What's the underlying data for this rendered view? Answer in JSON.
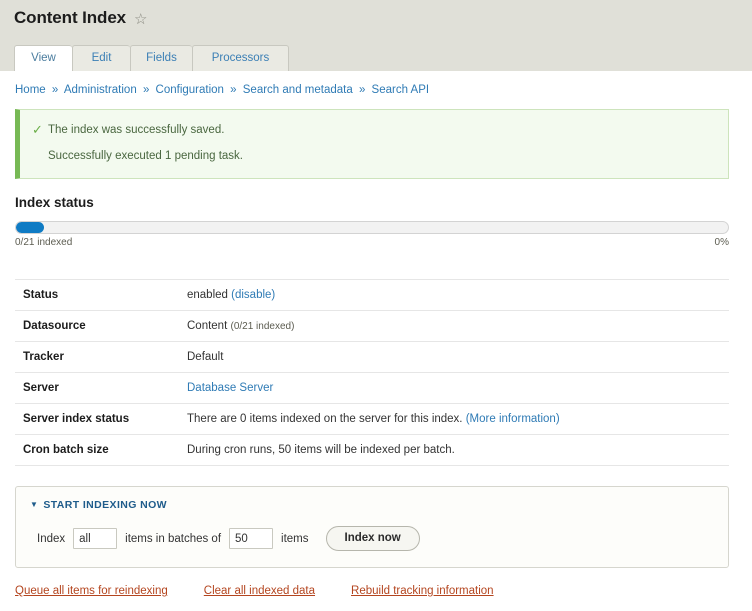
{
  "header": {
    "title": "Content Index",
    "star_icon": "star-outline-icon"
  },
  "tabs": [
    {
      "label": "View",
      "active": true
    },
    {
      "label": "Edit",
      "active": false
    },
    {
      "label": "Fields",
      "active": false
    },
    {
      "label": "Processors",
      "active": false
    }
  ],
  "breadcrumb": {
    "separator": "»",
    "items": [
      "Home",
      "Administration",
      "Configuration",
      "Search and metadata",
      "Search API"
    ]
  },
  "status_message": {
    "check_icon": "checkmark-icon",
    "lines": [
      "The index was successfully saved.",
      "Successfully executed 1 pending task."
    ]
  },
  "index_status": {
    "heading": "Index status",
    "progress_percent": 0,
    "progress_fill_width": "4%",
    "left_label": "0/21 indexed",
    "right_label": "0%"
  },
  "info_table": {
    "rows": [
      {
        "label": "Status",
        "value": "enabled",
        "link_text": "(disable)",
        "note": ""
      },
      {
        "label": "Datasource",
        "value": "Content",
        "link_text": "",
        "note": "(0/21 indexed)"
      },
      {
        "label": "Tracker",
        "value": "Default",
        "link_text": "",
        "note": ""
      },
      {
        "label": "Server",
        "value": "",
        "link_text": "Database Server",
        "note": ""
      },
      {
        "label": "Server index status",
        "value": "There are 0 items indexed on the server for this index.",
        "link_text": "(More information)",
        "note": ""
      },
      {
        "label": "Cron batch size",
        "value": "During cron runs, 50 items will be indexed per batch.",
        "link_text": "",
        "note": ""
      }
    ]
  },
  "indexing_box": {
    "legend": "START INDEXING NOW",
    "disclosure_icon": "triangle-down-icon",
    "prefix_label": "Index",
    "count_value": "all",
    "middle_label": "items in batches of",
    "batch_value": "50",
    "suffix_label": "items",
    "button_label": "Index now"
  },
  "action_links": [
    "Queue all items for reindexing",
    "Clear all indexed data",
    "Rebuild tracking information"
  ],
  "colors": {
    "header_band": "#e0e0d8",
    "link": "#2f7bb5",
    "action_link": "#b4451f",
    "progress_fill": "#0f7bc4",
    "message_border": "#77b955",
    "message_bg": "#f3faef"
  }
}
